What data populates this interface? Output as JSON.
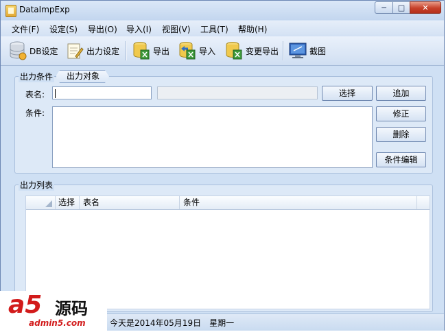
{
  "window": {
    "title": "DataImpExp",
    "minimize": "─",
    "maximize": "□",
    "close": "✕"
  },
  "menu": [
    "文件(F)",
    "设定(S)",
    "导出(O)",
    "导入(I)",
    "视图(V)",
    "工具(T)",
    "帮助(H)"
  ],
  "toolbar": {
    "db_setting": "DB设定",
    "output_setting": "出力设定",
    "export": "导出",
    "import": "导入",
    "change_export": "变更导出",
    "screenshot": "截图"
  },
  "conditions": {
    "group_label": "出力条件",
    "tab_label": "出力对象",
    "table_name_label": "表名:",
    "table_name_value": "",
    "condition_label": "条件:",
    "condition_value": "",
    "select_button": "选择",
    "add_button": "追加",
    "modify_button": "修正",
    "delete_button": "删除",
    "edit_condition_button": "条件编辑"
  },
  "output_list": {
    "group_label": "出力列表",
    "columns": [
      "选择",
      "表名",
      "条件"
    ],
    "rows": []
  },
  "status": {
    "text": "今天是2014年05月19日　星期一"
  },
  "watermark": {
    "logo": "a5",
    "name": "源码",
    "url": "admin5.com"
  },
  "colors": {
    "window_bg": "#cfe0f4",
    "close_button": "#c7412a",
    "watermark_red": "#d21b1b"
  }
}
